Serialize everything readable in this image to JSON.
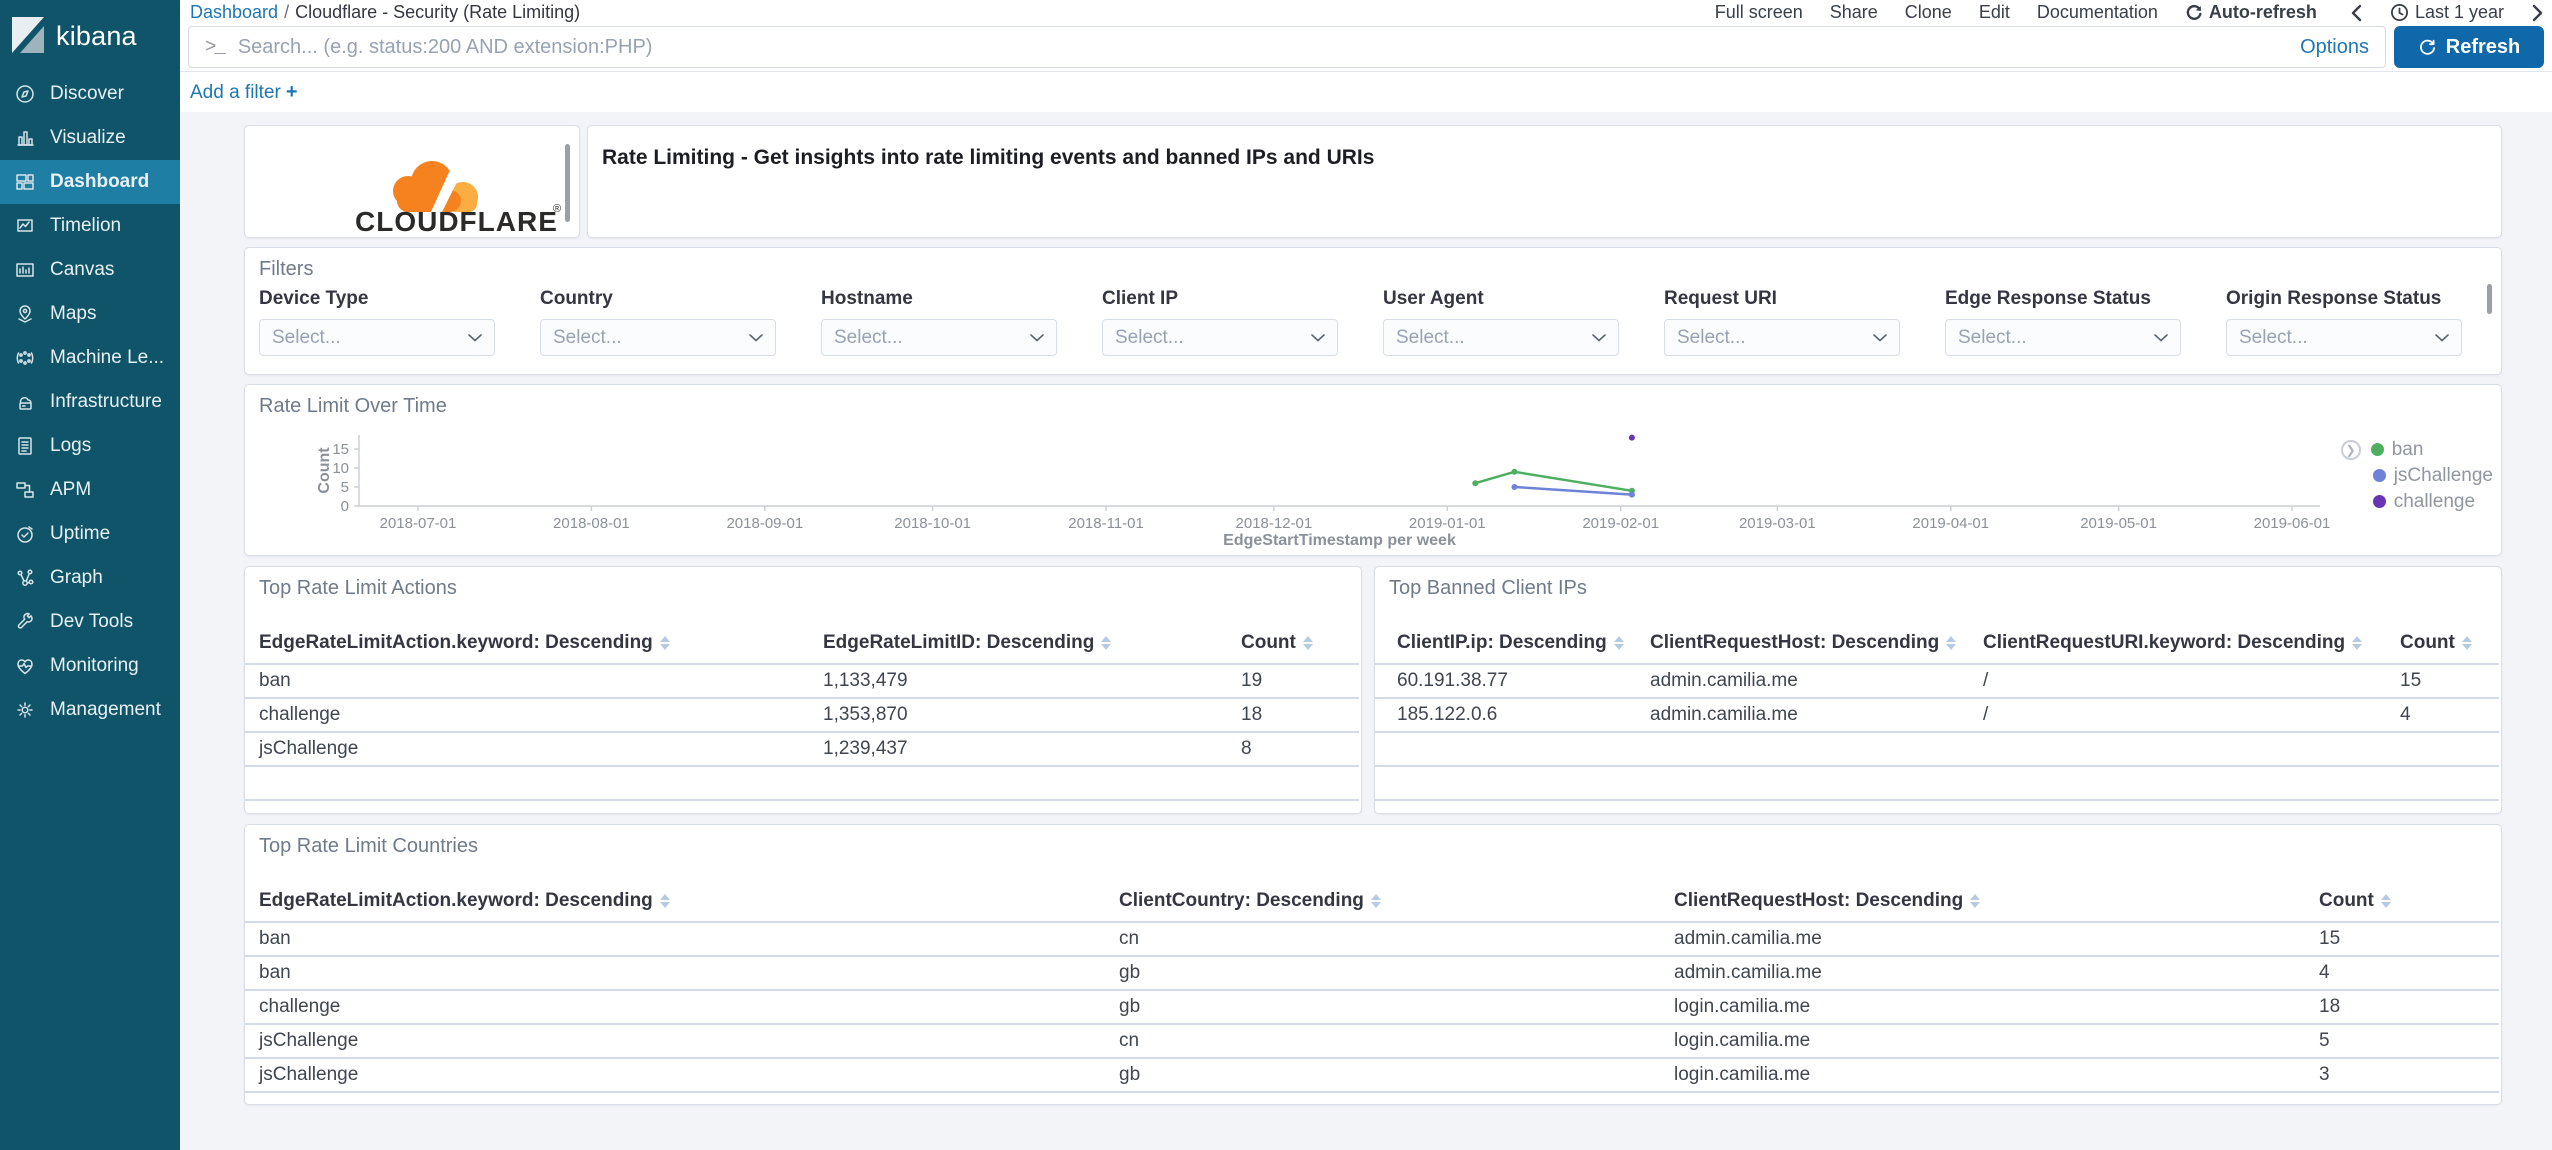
{
  "app": {
    "brand": "kibana"
  },
  "topbar": {
    "breadcrumb": {
      "link": "Dashboard",
      "separator": "/",
      "current": "Cloudflare - Security (Rate Limiting)"
    },
    "menu": [
      "Full screen",
      "Share",
      "Clone",
      "Edit",
      "Documentation"
    ],
    "auto_refresh_label": "Auto-refresh",
    "time_range": "Last 1 year"
  },
  "searchbar": {
    "placeholder": "Search... (e.g. status:200 AND extension:PHP)",
    "options_label": "Options",
    "refresh_label": "Refresh"
  },
  "filter_bar": {
    "add_filter_label": "Add a filter",
    "plus": "+"
  },
  "sidebar": {
    "items": [
      {
        "label": "Discover",
        "active": false
      },
      {
        "label": "Visualize",
        "active": false
      },
      {
        "label": "Dashboard",
        "active": true
      },
      {
        "label": "Timelion",
        "active": false
      },
      {
        "label": "Canvas",
        "active": false
      },
      {
        "label": "Maps",
        "active": false
      },
      {
        "label": "Machine Le...",
        "active": false
      },
      {
        "label": "Infrastructure",
        "active": false
      },
      {
        "label": "Logs",
        "active": false
      },
      {
        "label": "APM",
        "active": false
      },
      {
        "label": "Uptime",
        "active": false
      },
      {
        "label": "Graph",
        "active": false
      },
      {
        "label": "Dev Tools",
        "active": false
      },
      {
        "label": "Monitoring",
        "active": false
      },
      {
        "label": "Management",
        "active": false
      }
    ]
  },
  "panels": {
    "logo": {
      "brand": "CLOUDFLARE",
      "registered_mark": "®"
    },
    "markdown": {
      "text": "Rate Limiting - Get insights into rate limiting events and banned IPs and URIs"
    },
    "filters": {
      "title": "Filters",
      "fields": [
        {
          "label": "Device Type",
          "placeholder": "Select..."
        },
        {
          "label": "Country",
          "placeholder": "Select..."
        },
        {
          "label": "Hostname",
          "placeholder": "Select..."
        },
        {
          "label": "Client IP",
          "placeholder": "Select..."
        },
        {
          "label": "User Agent",
          "placeholder": "Select..."
        },
        {
          "label": "Request URI",
          "placeholder": "Select..."
        },
        {
          "label": "Edge Response Status",
          "placeholder": "Select..."
        },
        {
          "label": "Origin Response Status",
          "placeholder": "Select..."
        }
      ]
    },
    "actions_table": {
      "title": "Top Rate Limit Actions",
      "columns": [
        "EdgeRateLimitAction.keyword: Descending",
        "EdgeRateLimitID: Descending",
        "Count"
      ],
      "rows": [
        [
          "ban",
          "1,133,479",
          "19"
        ],
        [
          "challenge",
          "1,353,870",
          "18"
        ],
        [
          "jsChallenge",
          "1,239,437",
          "8"
        ]
      ],
      "empty_rows": 1
    },
    "banned_table": {
      "title": "Top Banned Client IPs",
      "columns": [
        "ClientIP.ip: Descending",
        "ClientRequestHost: Descending",
        "ClientRequestURI.keyword: Descending",
        "Count"
      ],
      "rows": [
        [
          "60.191.38.77",
          "admin.camilia.me",
          "/",
          "15"
        ],
        [
          "185.122.0.6",
          "admin.camilia.me",
          "/",
          "4"
        ]
      ],
      "empty_rows": 2
    },
    "countries_table": {
      "title": "Top Rate Limit Countries",
      "columns": [
        "EdgeRateLimitAction.keyword: Descending",
        "ClientCountry: Descending",
        "ClientRequestHost: Descending",
        "Count"
      ],
      "rows": [
        [
          "ban",
          "cn",
          "admin.camilia.me",
          "15"
        ],
        [
          "ban",
          "gb",
          "admin.camilia.me",
          "4"
        ],
        [
          "challenge",
          "gb",
          "login.camilia.me",
          "18"
        ],
        [
          "jsChallenge",
          "cn",
          "login.camilia.me",
          "5"
        ],
        [
          "jsChallenge",
          "gb",
          "login.camilia.me",
          "3"
        ]
      ],
      "empty_rows": 0
    }
  },
  "chart_data": {
    "type": "line",
    "title": "Rate Limit Over Time",
    "xlabel": "EdgeStartTimestamp per week",
    "ylabel": "Count",
    "x_ticks": [
      "2018-07-01",
      "2018-08-01",
      "2018-09-01",
      "2018-10-01",
      "2018-11-01",
      "2018-12-01",
      "2019-01-01",
      "2019-02-01",
      "2019-03-01",
      "2019-04-01",
      "2019-05-01",
      "2019-06-01"
    ],
    "y_ticks": [
      0,
      5,
      10,
      15
    ],
    "ylim": [
      0,
      18.5
    ],
    "grid": false,
    "legend_position": "right",
    "series": [
      {
        "name": "ban",
        "color": "#4daf5f",
        "points": [
          [
            "2019-01-06",
            6
          ],
          [
            "2019-01-13",
            9
          ],
          [
            "2019-02-03",
            4
          ]
        ]
      },
      {
        "name": "jsChallenge",
        "color": "#6e82d6",
        "points": [
          [
            "2019-01-13",
            5
          ],
          [
            "2019-02-03",
            3
          ]
        ]
      },
      {
        "name": "challenge",
        "color": "#6a35b5",
        "points": [
          [
            "2019-02-03",
            18
          ]
        ]
      }
    ],
    "colors": {
      "axis": "#ccd0d6",
      "tick_text": "#8b9199"
    }
  }
}
